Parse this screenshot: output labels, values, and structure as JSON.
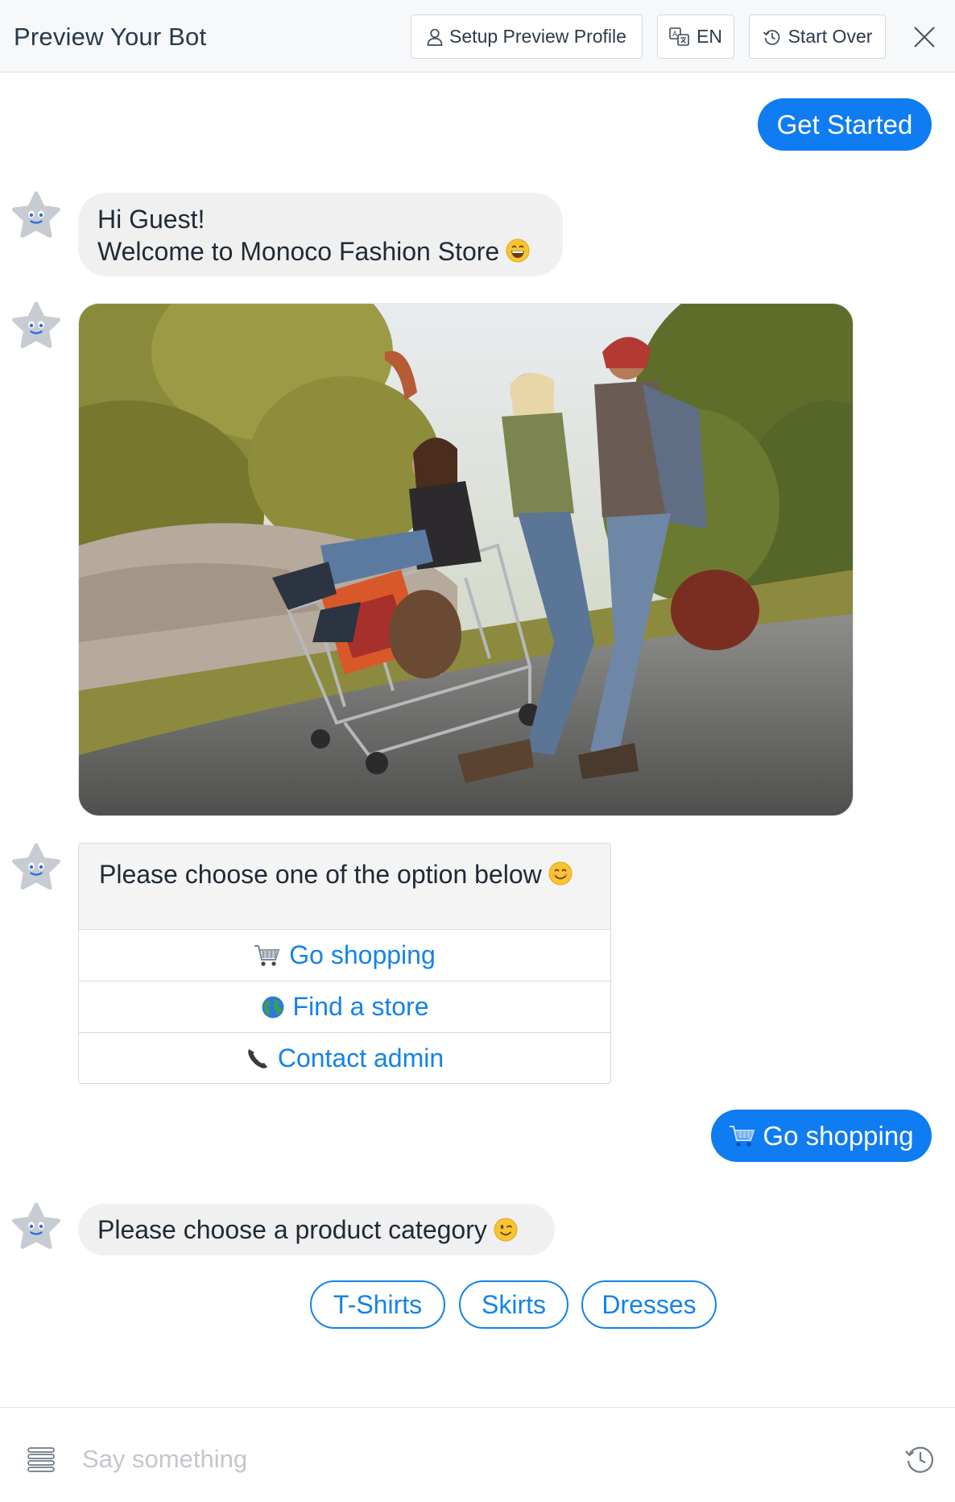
{
  "header": {
    "title": "Preview Your Bot",
    "profile_label": "Setup Preview Profile",
    "lang_label": "EN",
    "restart_label": "Start Over"
  },
  "chat": {
    "get_started": "Get Started",
    "welcome_line1": "Hi Guest!",
    "welcome_line2": "Welcome to Monoco Fashion Store",
    "options_prompt": "Please choose one of the option below",
    "options": [
      {
        "label": "Go shopping",
        "icon": "shopping-cart-icon"
      },
      {
        "label": "Find a store",
        "icon": "globe-icon"
      },
      {
        "label": "Contact admin",
        "icon": "telephone-icon"
      }
    ],
    "user_choice": "Go shopping",
    "category_prompt": "Please choose a product category",
    "quick_replies": [
      "T-Shirts",
      "Skirts",
      "Dresses"
    ]
  },
  "composer": {
    "placeholder": "Say something"
  },
  "colors": {
    "accent": "#0f7cf2",
    "link": "#1583e6",
    "bubble": "#f0f0f0",
    "header_bg": "#f7f8fa"
  }
}
